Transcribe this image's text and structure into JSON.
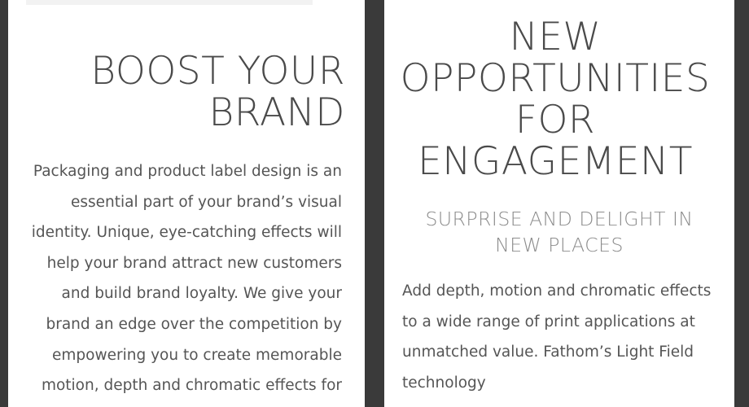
{
  "left_card": {
    "headline": "BOOST YOUR\nBRAND",
    "body": "Packaging and product label design is an essential part of your brand’s visual identity. Unique, eye-catching effects will help your brand attract new customers and build brand loyalty. We give your brand an edge over the competition by empowering you to create memorable motion, depth and chromatic effects for"
  },
  "right_card": {
    "headline": "NEW\nOPPORTUNITIES\nFOR\nENGAGEMENT",
    "subheading": "SURPRISE AND DELIGHT IN\nNEW PLACES",
    "body": "Add depth, motion and chromatic effects to a wide range of print applications at unmatched value. Fathom’s Light Field technology"
  }
}
